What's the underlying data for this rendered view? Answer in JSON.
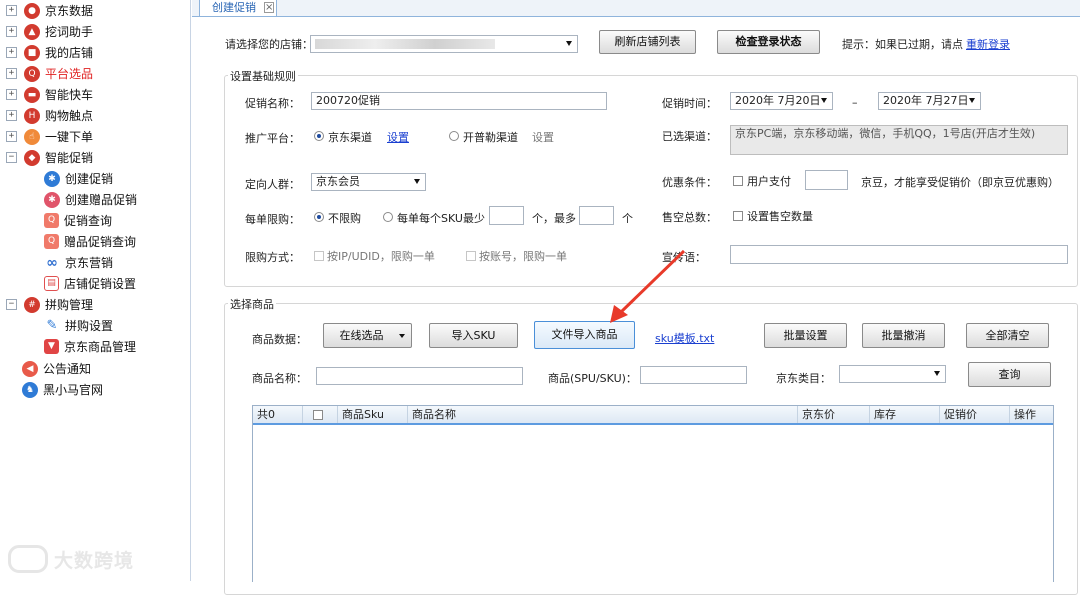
{
  "sidebar": {
    "items": [
      {
        "label": "京东数据"
      },
      {
        "label": "挖词助手"
      },
      {
        "label": "我的店铺"
      },
      {
        "label": "平台选品"
      },
      {
        "label": "智能快车"
      },
      {
        "label": "购物触点"
      },
      {
        "label": "一键下单"
      },
      {
        "label": "智能促销",
        "children": [
          {
            "label": "创建促销"
          },
          {
            "label": "创建赠品促销"
          },
          {
            "label": "促销查询"
          },
          {
            "label": "赠品促销查询"
          },
          {
            "label": "京东营销"
          },
          {
            "label": "店铺促销设置"
          }
        ]
      },
      {
        "label": "拼购管理",
        "children": [
          {
            "label": "拼购设置"
          },
          {
            "label": "京东商品管理"
          }
        ]
      },
      {
        "label": "公告通知"
      },
      {
        "label": "黑小马官网"
      }
    ],
    "active_color": "#e02222"
  },
  "watermark": "大数跨境",
  "tab": {
    "label": "创建促销"
  },
  "header": {
    "store_label": "请选择您的店铺：",
    "refresh_button": "刷新店铺列表",
    "check_button": "检查登录状态",
    "hint": "提示：如果已过期，请点",
    "relogin_link": "重新登录"
  },
  "rules": {
    "title": "设置基础规则",
    "name_label": "促销名称：",
    "name_value": "200720促销",
    "time_label": "促销时间：",
    "start_date": "2020年 7月20日",
    "dash": "–",
    "end_date": "2020年 7月27日",
    "platform_label": "推广平台：",
    "jd_channel": "京东渠道",
    "jd_settings": "设置",
    "kpl_channel": "开普勒渠道",
    "kpl_settings": "设置",
    "selected_channel_label": "已选渠道：",
    "selected_channel_value": "京东PC端，京东移动端，微信，手机QQ，1号店(开店才生效)",
    "target_label": "定向人群：",
    "target_value": "京东会员",
    "discount_label": "优惠条件：",
    "user_pay": "用户支付",
    "discount_suffix": "京豆，才能享受促销价（即京豆优惠购）",
    "limit_label": "每单限购：",
    "no_limit": "不限购",
    "per_sku_prefix": "每单每个SKU最少",
    "per_sku_mid": "个，最多",
    "per_sku_suffix": "个",
    "soldout_label": "售空总数：",
    "soldout_option": "设置售空数量",
    "method_label": "限购方式：",
    "ip_option": "按IP/UDID，限购一单",
    "account_option": "按账号，限购一单",
    "slogan_label": "宣传语："
  },
  "products": {
    "title": "选择商品",
    "data_label": "商品数据：",
    "online_select": "在线选品",
    "import_sku": "导入SKU",
    "file_import": "文件导入商品",
    "template_link": "sku模板.txt",
    "batch_set": "批量设置",
    "batch_cancel": "批量撤消",
    "clear_all": "全部清空",
    "name_label": "商品名称：",
    "spu_label": "商品(SPU/SKU)：",
    "category_label": "京东类目：",
    "query_button": "查询"
  },
  "grid": {
    "columns": [
      "共0",
      "",
      "商品Sku",
      "商品名称",
      "京东价",
      "库存",
      "促销价",
      "操作"
    ]
  },
  "colors": {
    "arrow": "#e83a2a",
    "link": "#1a3fd0",
    "header_border": "#5d9be0"
  }
}
